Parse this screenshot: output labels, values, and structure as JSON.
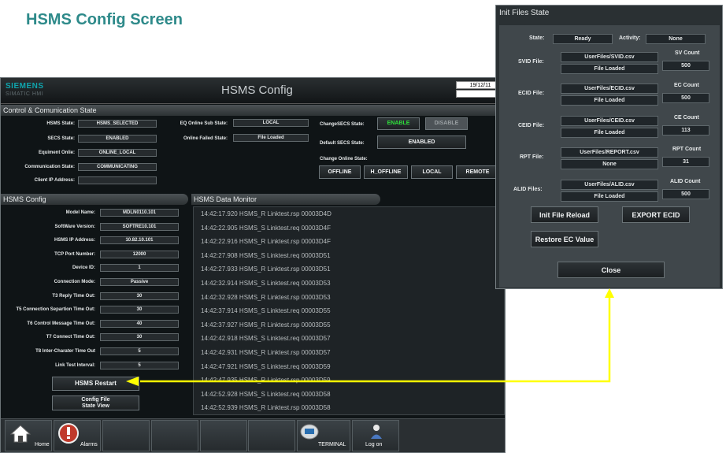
{
  "slide_title": "HSMS Config Screen",
  "hmi": {
    "logo": "SIEMENS",
    "logo_sub": "SIMATIC HMI",
    "title": "HSMS Config",
    "date": "19/12/11"
  },
  "control_state": {
    "section": "Control & Comunication State",
    "hsms_state_label": "HSMS State:",
    "hsms_state": "HSMS_SELECTED",
    "secs_state_label": "SECS State:",
    "secs_state": "ENABLED",
    "equipment_online_label": "Equiment Onlie:",
    "equipment_online": "ONLINE_LOCAL",
    "comm_state_label": "Communication State:",
    "comm_state": "COMMUNICATING",
    "client_ip_label": "Client IP Address:",
    "client_ip": "",
    "eq_online_sub_label": "EQ Online Sub State:",
    "eq_online_sub": "LOCAL",
    "online_failed_label": "Online Failed State:",
    "online_failed": "File Loaded",
    "change_secs_label": "ChangeSECS State:",
    "enable_btn": "ENABLE",
    "disable_btn": "DISABLE",
    "default_secs_label": "Default SECS State:",
    "default_secs": "ENABLED",
    "change_online_label": "Change Online State:",
    "offline_btn": "OFFLINE",
    "h_offline_btn": "H_OFFLINE",
    "local_btn": "LOCAL",
    "remote_btn": "REMOTE"
  },
  "hsms_config": {
    "section": "HSMS Config",
    "fields": [
      {
        "label": "Model Name:",
        "value": "MDLN0110.101"
      },
      {
        "label": "SoftWare Version:",
        "value": "SOFTRE10.101"
      },
      {
        "label": "HSMS IP Address:",
        "value": "10.82.10.101"
      },
      {
        "label": "TCP Port Number:",
        "value": "12000"
      },
      {
        "label": "Device ID:",
        "value": "1"
      },
      {
        "label": "Connection Mode:",
        "value": "Passive"
      },
      {
        "label": "T3 Reply Time Out:",
        "value": "30"
      },
      {
        "label": "T5 Connection Separtion Time Out:",
        "value": "30"
      },
      {
        "label": "T6 Control Message Time Out:",
        "value": "40"
      },
      {
        "label": "T7 Connect Time Out:",
        "value": "30"
      },
      {
        "label": "T8 Inter-Charater Time Out",
        "value": "5"
      },
      {
        "label": "Link Test Interval:",
        "value": "5"
      }
    ],
    "restart_btn": "HSMS Restart",
    "config_file_btn_1": "Config File",
    "config_file_btn_2": "State View"
  },
  "monitor": {
    "section": "HSMS Data Monitor",
    "lines": [
      "14:42:17.920 HSMS_R Linktest.rsp 00003D4D",
      "14:42:22.905 HSMS_S Linktest.req 00003D4F",
      "14:42:22.916 HSMS_R Linktest.rsp 00003D4F",
      "14:42:27.908 HSMS_S Linktest.req 00003D51",
      "14:42:27.933 HSMS_R Linktest.rsp 00003D51",
      "14:42:32.914 HSMS_S Linktest.req 00003D53",
      "14:42:32.928 HSMS_R Linktest.rsp 00003D53",
      "14:42:37.914 HSMS_S Linktest.req 00003D55",
      "14:42:37.927 HSMS_R Linktest.rsp 00003D55",
      "14:42:42.918 HSMS_S Linktest.req 00003D57",
      "14:42:42.931 HSMS_R Linktest.rsp 00003D57",
      "14:42:47.921 HSMS_S Linktest.req 00003D59",
      "14:42:47.935 HSMS_R Linktest.rsp 00003D59",
      "14:42:52.928 HSMS_S Linktest.req 00003D58",
      "14:42:52.939 HSMS_R Linktest.rsp 00003D58"
    ]
  },
  "nav": {
    "home": "Home",
    "alarms": "Alarms",
    "terminal": "TERMINAL",
    "logon": "Log on"
  },
  "init_files": {
    "title": "Init Files State",
    "state_label": "State:",
    "state": "Ready",
    "activity_label": "Activity:",
    "activity": "None",
    "svid_label": "SVID File:",
    "svid_file": "UserFiles/SVID.csv",
    "svid_status": "File Loaded",
    "sv_count_label": "SV Count",
    "sv_count": "500",
    "ecid_label": "ECID File:",
    "ecid_file": "UserFiles/ECID.csv",
    "ecid_status": "File Loaded",
    "ec_count_label": "EC Count",
    "ec_count": "500",
    "ceid_label": "CEID File:",
    "ceid_file": "UserFiles/CEID.csv",
    "ceid_status": "File Loaded",
    "ce_count_label": "CE Count",
    "ce_count": "113",
    "rpt_label": "RPT File:",
    "rpt_file": "UserFiles/REPORT.csv",
    "rpt_status": "None",
    "rpt_count_label": "RPT Count",
    "rpt_count": "31",
    "alid_label": "ALID Files:",
    "alid_file": "UserFiles/ALID.csv",
    "alid_status": "File Loaded",
    "alid_count_label": "ALID Count",
    "alid_count": "500",
    "reload_btn": "Init File Reload",
    "export_btn": "EXPORT ECID",
    "restore_btn": "Restore EC Value",
    "close_btn": "Close"
  },
  "colors": {
    "connector": "#ffff00",
    "title": "#2e8a8a",
    "enable_green": "#2ee03a"
  }
}
